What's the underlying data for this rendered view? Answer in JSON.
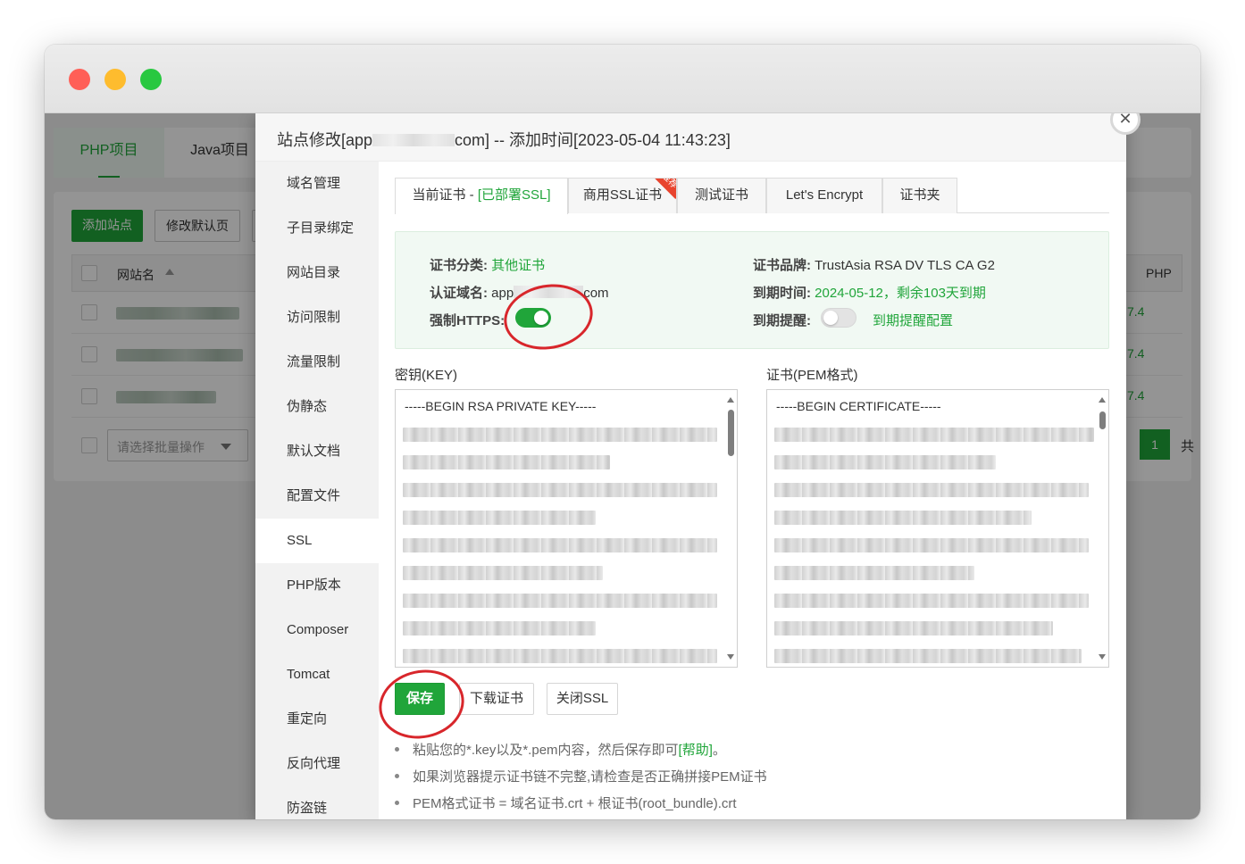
{
  "window": {
    "traffic_colors": [
      "#ff5f57",
      "#febc2e",
      "#28c840"
    ]
  },
  "background": {
    "tabs": [
      "PHP项目",
      "Java项目"
    ],
    "buttons": {
      "add_site": "添加站点",
      "modify_default": "修改默认页"
    },
    "table": {
      "col_site_name": "网站名",
      "col_php": "PHP",
      "php_versions": [
        "7.4",
        "7.4",
        "7.4"
      ]
    },
    "batch_select_placeholder": "请选择批量操作",
    "pagination": {
      "current_page": "1",
      "total_prefix": "共"
    }
  },
  "dialog": {
    "title_prefix": "站点修改[app",
    "title_suffix": "com] -- 添加时间[2023-05-04 11:43:23]",
    "close_symbol": "✕",
    "nav": [
      "域名管理",
      "子目录绑定",
      "网站目录",
      "访问限制",
      "流量限制",
      "伪静态",
      "默认文档",
      "配置文件",
      "SSL",
      "PHP版本",
      "Composer",
      "Tomcat",
      "重定向",
      "反向代理",
      "防盗链"
    ],
    "nav_active": "SSL",
    "tabs": {
      "current_cert": "当前证书 - ",
      "current_cert_status": "[已部署SSL]",
      "commercial": "商用SSL证书",
      "commercial_badge": "推荐",
      "test_cert": "测试证书",
      "lets_encrypt": "Let's Encrypt",
      "cert_folder": "证书夹"
    },
    "info": {
      "cert_type_label": "证书分类:",
      "cert_type_value": "其他证书",
      "domain_label": "认证域名:",
      "domain_prefix": "app",
      "domain_suffix": "com",
      "force_https_label": "强制HTTPS:",
      "force_https_on": true,
      "brand_label": "证书品牌:",
      "brand_value": "TrustAsia RSA DV TLS CA G2",
      "expire_label": "到期时间:",
      "expire_value": "2024-05-12，剩余103天到期",
      "remind_label": "到期提醒:",
      "remind_on": false,
      "remind_config_link": "到期提醒配置"
    },
    "key": {
      "label": "密钥(KEY)",
      "first_line": "-----BEGIN RSA PRIVATE KEY-----"
    },
    "cert": {
      "label": "证书(PEM格式)",
      "first_line": "-----BEGIN CERTIFICATE-----"
    },
    "buttons": {
      "save": "保存",
      "download": "下载证书",
      "close_ssl": "关闭SSL"
    },
    "tips": {
      "tip1_text": "粘贴您的*.key以及*.pem内容，然后保存即可",
      "tip1_link": "[帮助]",
      "tip1_end": "。",
      "tip2": "如果浏览器提示证书链不完整,请检查是否正确拼接PEM证书",
      "tip3": "PEM格式证书 = 域名证书.crt + 根证书(root_bundle).crt"
    },
    "accent_color": "#20a53a",
    "annotation_color": "#d8262b"
  }
}
